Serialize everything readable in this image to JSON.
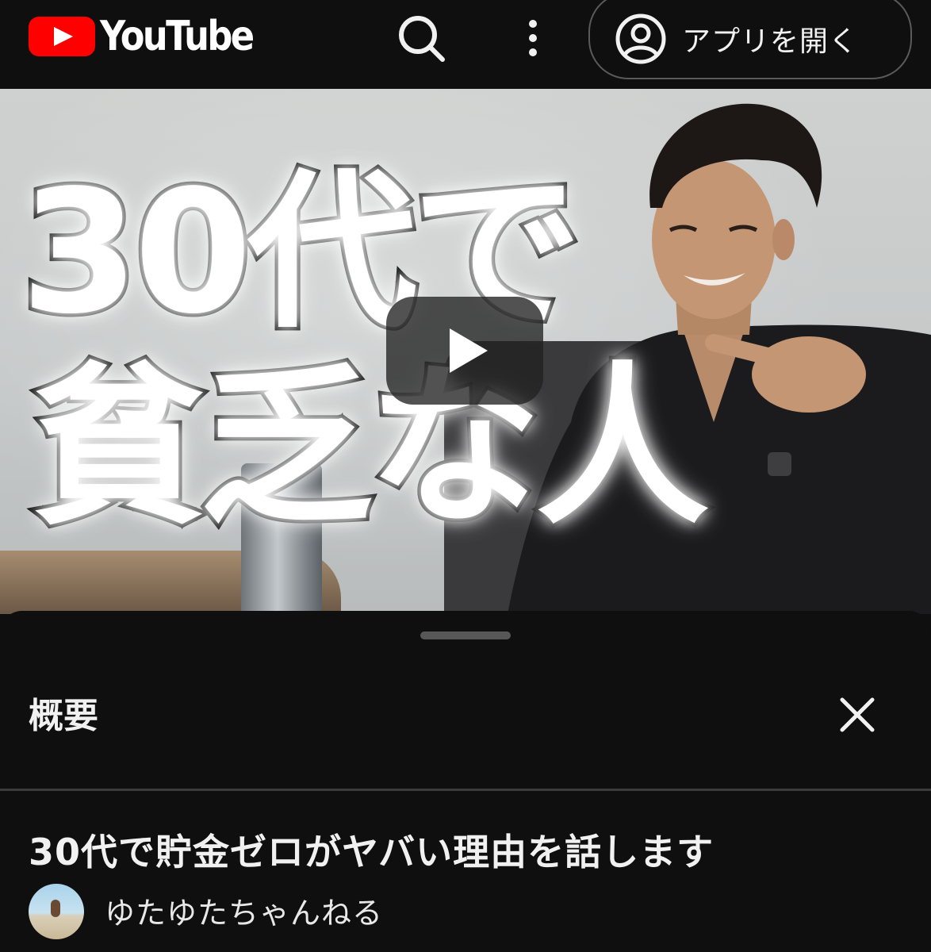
{
  "header": {
    "logo_text": "YouTube",
    "app_button_label": "アプリを開く",
    "icons": [
      "youtube-logo",
      "search-icon",
      "more-vert-icon",
      "account-circle-icon"
    ],
    "brand_color": "#ff0000"
  },
  "video": {
    "thumbnail_text_line1": "30代で",
    "thumbnail_text_line2": "貧乏な人",
    "play_icon": "play-icon"
  },
  "panel": {
    "title": "概要",
    "close_icon": "close-icon",
    "video_title": "30代で貯金ゼロがヤバい理由を話します",
    "channel_name": "ゆたゆたちゃんねる"
  }
}
